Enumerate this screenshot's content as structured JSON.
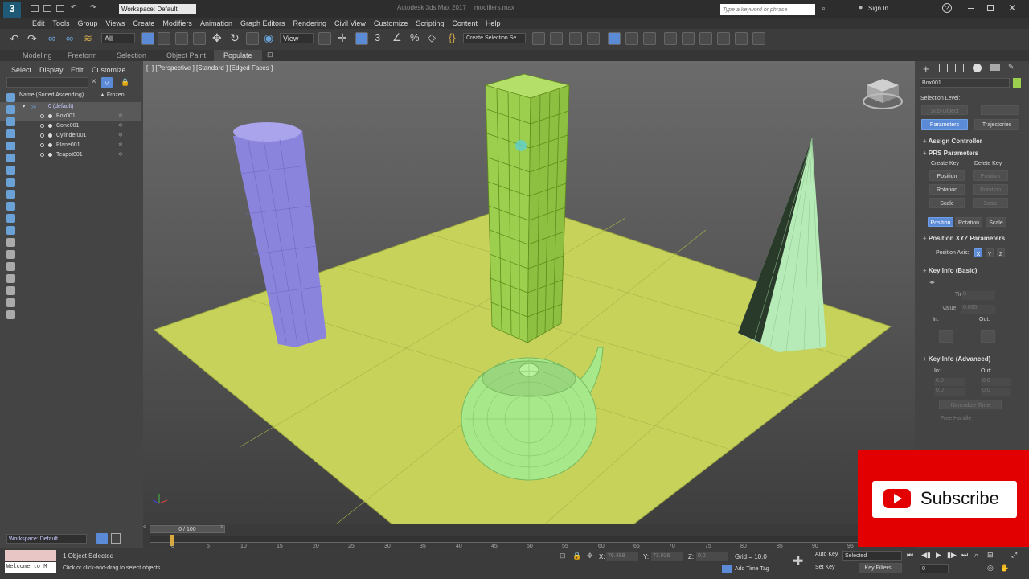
{
  "titlebar": {
    "app_number": "3",
    "workspace": "Workspace: Default",
    "title_left": "Autodesk 3ds Max 2017",
    "title_right": "modifiers.max",
    "search_placeholder": "Type a keyword or phrase",
    "sign_in": "Sign In",
    "help": "?"
  },
  "menu": [
    "Edit",
    "Tools",
    "Group",
    "Views",
    "Create",
    "Modifiers",
    "Animation",
    "Graph Editors",
    "Rendering",
    "Civil View",
    "Customize",
    "Scripting",
    "Content",
    "Help"
  ],
  "toolbar": {
    "filter_value": "All",
    "view_value": "View",
    "selection_set_placeholder": "Create Selection Se"
  },
  "ribbon_tabs": [
    "Modeling",
    "Freeform",
    "Selection",
    "Object Paint",
    "Populate"
  ],
  "scene_explorer": {
    "tabs": [
      "Select",
      "Display",
      "Edit",
      "Customize"
    ],
    "column_name": "Name (Sorted Ascending)",
    "column_frozen": "▲ Frozen",
    "layer": "0 (default)",
    "objects": [
      "Box001",
      "Cone001",
      "Cylinder001",
      "Plane001",
      "Teapot001"
    ],
    "selected": "Box001"
  },
  "viewport": {
    "label": "[+] [Perspective ] [Standard ] [Edged Faces ]"
  },
  "command_panel": {
    "object_name": "Box001",
    "selection_level": "Selection Level:",
    "sub_object": "Sub-Object",
    "tab_parameters": "Parameters",
    "tab_trajectories": "Trajectories",
    "assign_controller": "Assign Controller",
    "prs_parameters": "PRS Parameters",
    "create_key": "Create Key",
    "delete_key": "Delete Key",
    "position": "Position",
    "rotation": "Rotation",
    "scale": "Scale",
    "position_xyz": "Position XYZ Parameters",
    "position_axis": "Position Axis:",
    "axis_x": "X",
    "axis_y": "Y",
    "axis_z": "Z",
    "key_info_basic": "Key Info (Basic)",
    "time_label": "Time:",
    "time_value": "0",
    "value_label": "Value:",
    "value_value": "0.865",
    "in_label": "In:",
    "out_label": "Out:",
    "key_info_advanced": "Key Info (Advanced)",
    "adv_in_1": "0.0",
    "adv_in_2": "0.0",
    "adv_out_1": "0.0",
    "adv_out_2": "0.0",
    "normalize_time": "Normalize Time",
    "free_handle": "Free Handle"
  },
  "timeline": {
    "frame_counter": "0 / 100",
    "ticks": [
      "0",
      "5",
      "10",
      "15",
      "20",
      "25",
      "30",
      "35",
      "40",
      "45",
      "50",
      "55",
      "60",
      "65",
      "70",
      "75",
      "80",
      "85",
      "90",
      "95"
    ]
  },
  "status": {
    "workspace": "Workspace: Default",
    "maxscript": "Welcome to M",
    "selected": "1 Object Selected",
    "prompt": "Click or click-and-drag to select objects",
    "x_label": "X:",
    "x_value": "76.498",
    "y_label": "Y:",
    "y_value": "73.036",
    "z_label": "Z:",
    "z_value": "0.0",
    "grid": "Grid = 10.0",
    "add_time_tag": "Add Time Tag",
    "auto_key": "Auto Key",
    "auto_key_value": "Selected",
    "set_key": "Set Key",
    "key_filters": "Key Filters...",
    "frame": "0"
  },
  "overlay": {
    "subscribe": "Subscribe"
  },
  "colors": {
    "plane": "#c6d25a",
    "cylinder": "#8a84dc",
    "box": "#9ccf4e",
    "cone": "#b6eab6",
    "teapot": "#a6e88a",
    "accent": "#5b8bd6",
    "youtube": "#e20000"
  }
}
